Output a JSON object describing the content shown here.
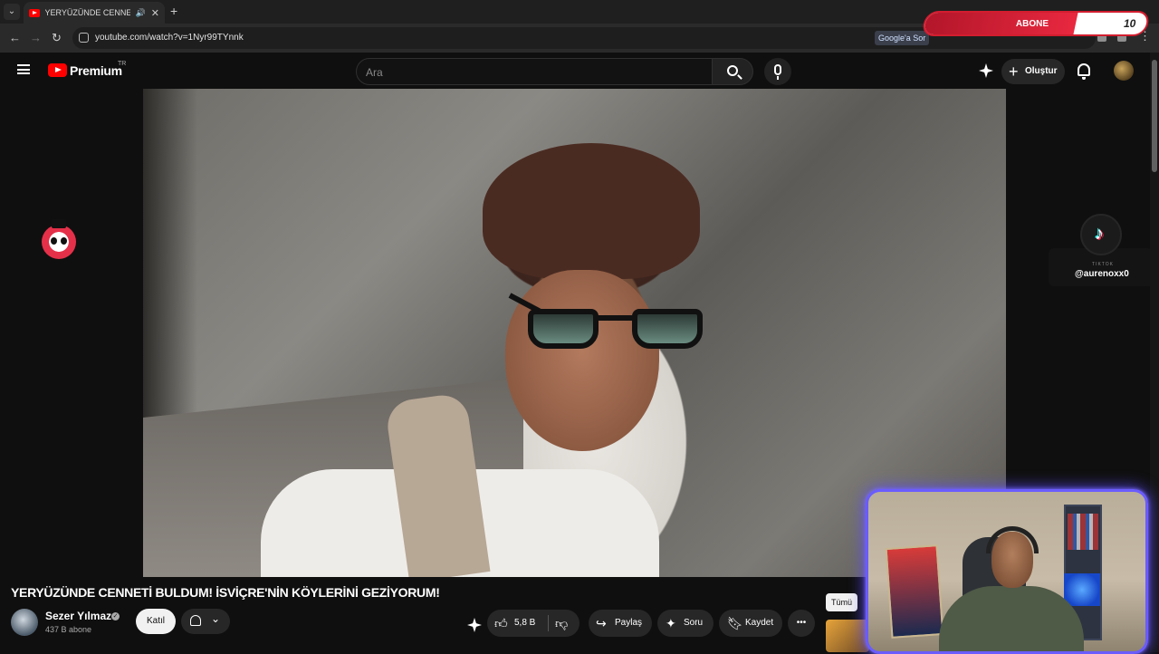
{
  "browser": {
    "tab_title": "YERYÜZÜNDE CENNETİ BU",
    "url": "youtube.com/watch?v=1Nyr99TYnnk",
    "google_search_chip": "Google'a Sor"
  },
  "overlay": {
    "abone_label": "ABONE",
    "abone_count": "10",
    "abone_progress": 0.68,
    "tiktok_label": "TIKTOK",
    "tiktok_handle": "@aurenoxx0"
  },
  "header": {
    "brand": "Premium",
    "region": "TR",
    "search_placeholder": "Ara",
    "create_label": "Oluştur"
  },
  "video": {
    "title": "YERYÜZÜNDE CENNETİ BULDUM! İSVİÇRE'NİN KÖYLERİNİ GEZİYORUM!",
    "channel_name": "Sezer Yılmaz",
    "subscribers": "437 B abone",
    "join_label": "Katıl",
    "likes": "5,8 B",
    "share_label": "Paylaş",
    "ask_label": "Soru",
    "save_label": "Kaydet"
  },
  "recommendations": {
    "filter_chip": "Tümü"
  },
  "colors": {
    "background": "#0f0f0f",
    "youtube_red": "#ff0000",
    "pill": "#272727",
    "abone_red": "#d21d2f",
    "webcam_glow": "#6a5cff"
  }
}
